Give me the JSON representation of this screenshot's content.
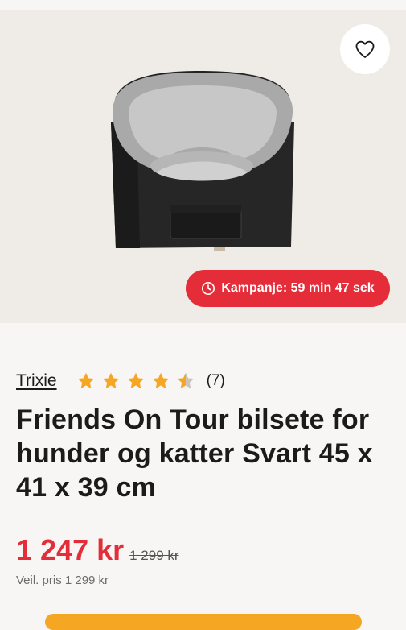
{
  "product": {
    "brand": "Trixie",
    "rating": 4.5,
    "review_count": "(7)",
    "title": "Friends On Tour bilsete for hunder og katter Svart 45 x 41 x 39 cm",
    "price": "1 247 kr",
    "old_price": "1 299 kr",
    "recommended_price": "Veil. pris 1 299 kr"
  },
  "campaign": {
    "label": "Kampanje: 59 min 47 sek",
    "icon": "clock-icon"
  },
  "favorite": {
    "icon": "heart-icon"
  },
  "colors": {
    "accent_red": "#e52d3a",
    "star_gold": "#f5a623",
    "star_empty": "#c9c4bd",
    "hero_bg": "#efece8",
    "page_bg": "#f8f6f4"
  }
}
